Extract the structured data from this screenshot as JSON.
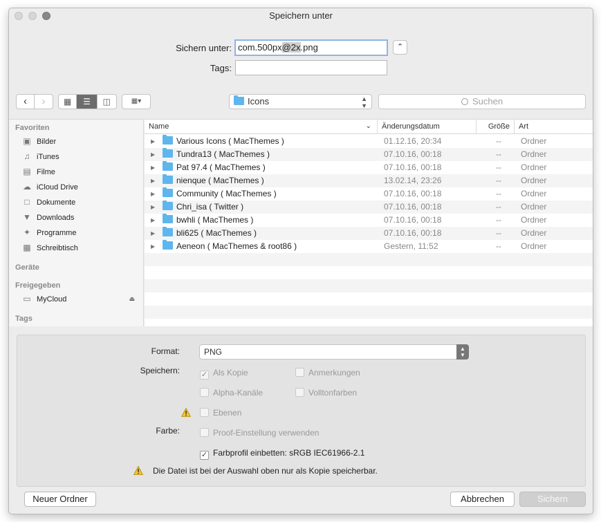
{
  "window": {
    "title": "Speichern unter"
  },
  "save": {
    "name_label": "Sichern unter:",
    "filename_prefix": "com.500px",
    "filename_selected": "@2x",
    "filename_suffix": ".png",
    "tags_label": "Tags:",
    "tags_value": ""
  },
  "toolbar": {
    "location": "Icons",
    "search_placeholder": "Suchen"
  },
  "sidebar": {
    "sections": [
      {
        "title": "Favoriten",
        "items": [
          {
            "label": "Bilder",
            "icon": "camera-icon"
          },
          {
            "label": "iTunes",
            "icon": "music-note-icon"
          },
          {
            "label": "Filme",
            "icon": "film-icon"
          },
          {
            "label": "iCloud Drive",
            "icon": "cloud-icon"
          },
          {
            "label": "Dokumente",
            "icon": "document-icon"
          },
          {
            "label": "Downloads",
            "icon": "download-icon"
          },
          {
            "label": "Programme",
            "icon": "apps-icon"
          },
          {
            "label": "Schreibtisch",
            "icon": "desktop-icon"
          }
        ]
      },
      {
        "title": "Geräte",
        "items": []
      },
      {
        "title": "Freigegeben",
        "items": [
          {
            "label": "MyCloud",
            "icon": "monitor-icon"
          }
        ]
      },
      {
        "title": "Tags",
        "items": []
      }
    ]
  },
  "list": {
    "columns": [
      "Name",
      "Änderungsdatum",
      "Größe",
      "Art"
    ],
    "rows": [
      {
        "name": "Various Icons ( MacThemes )",
        "date": "01.12.16, 20:34",
        "size": "--",
        "kind": "Ordner"
      },
      {
        "name": "Tundra13 ( MacThemes )",
        "date": "07.10.16, 00:18",
        "size": "--",
        "kind": "Ordner"
      },
      {
        "name": "Pat 97.4 ( MacThemes )",
        "date": "07.10.16, 00:18",
        "size": "--",
        "kind": "Ordner"
      },
      {
        "name": "nienque ( MacThemes )",
        "date": "13.02.14, 23:26",
        "size": "--",
        "kind": "Ordner"
      },
      {
        "name": "Community ( MacThemes )",
        "date": "07.10.16, 00:18",
        "size": "--",
        "kind": "Ordner"
      },
      {
        "name": "Chri_isa ( Twitter )",
        "date": "07.10.16, 00:18",
        "size": "--",
        "kind": "Ordner"
      },
      {
        "name": "bwhli ( MacThemes )",
        "date": "07.10.16, 00:18",
        "size": "--",
        "kind": "Ordner"
      },
      {
        "name": "bli625 ( MacThemes )",
        "date": "07.10.16, 00:18",
        "size": "--",
        "kind": "Ordner"
      },
      {
        "name": "Aeneon ( MacThemes & root86 )",
        "date": "Gestern, 11:52",
        "size": "--",
        "kind": "Ordner"
      }
    ]
  },
  "options": {
    "format_label": "Format:",
    "format_value": "PNG",
    "save_label": "Speichern:",
    "color_label": "Farbe:",
    "checks": {
      "as_copy": "Als Kopie",
      "annotations": "Anmerkungen",
      "alpha": "Alpha-Kanäle",
      "spot_colors": "Volltonfarben",
      "layers": "Ebenen",
      "proof": "Proof-Einstellung verwenden",
      "embed_profile": "Farbprofil einbetten: sRGB IEC61966-2.1"
    },
    "warning_text": "Die Datei ist bei der Auswahl oben nur als Kopie speicherbar."
  },
  "buttons": {
    "new_folder": "Neuer Ordner",
    "cancel": "Abbrechen",
    "save": "Sichern"
  },
  "colors": {
    "accent_focus": "#8fb3e8",
    "folder": "#5eb6ec",
    "warning": "#f2c230"
  }
}
